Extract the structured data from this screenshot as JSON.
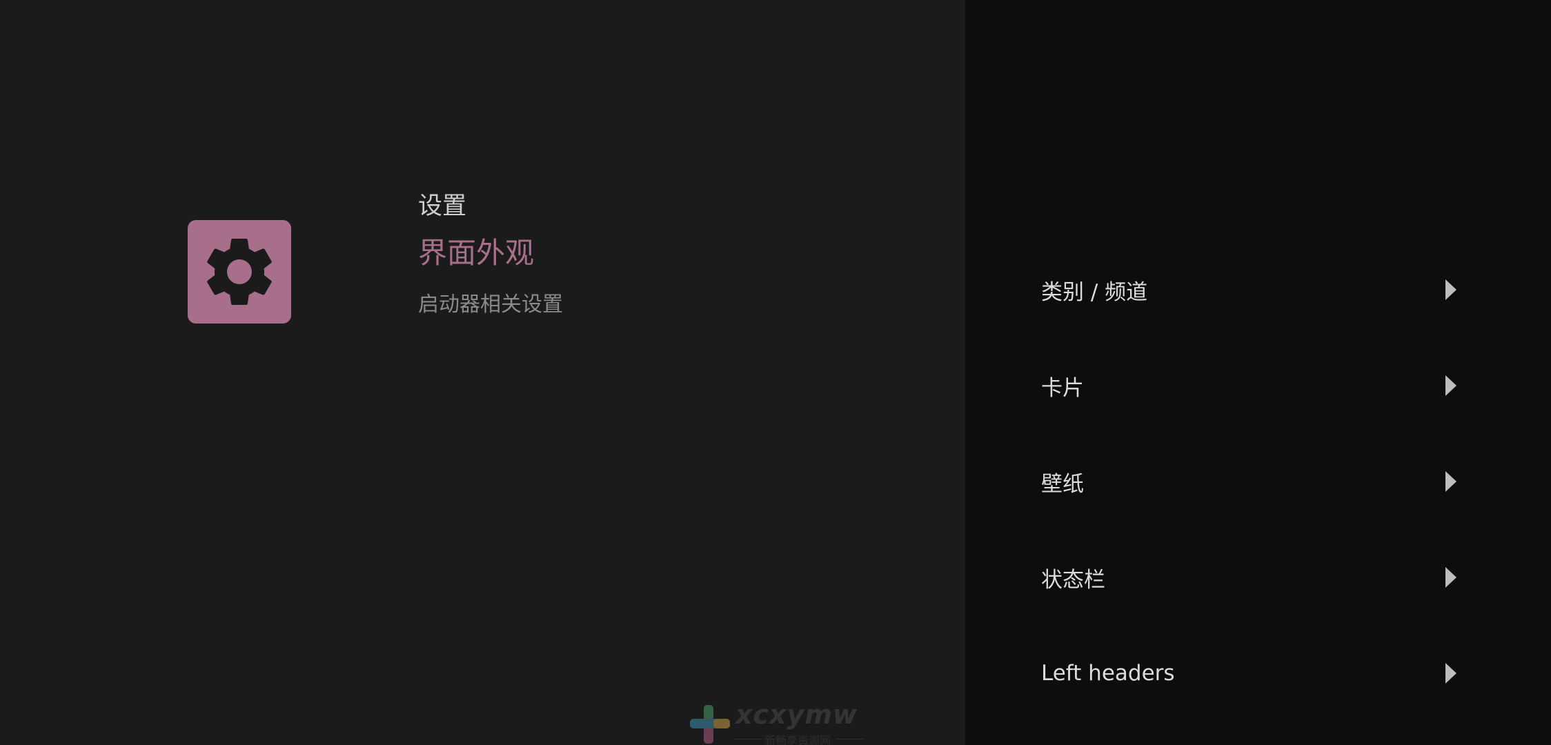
{
  "header": {
    "breadcrumb": "设置",
    "title": "界面外观",
    "description": "启动器相关设置",
    "icon": "gear-icon"
  },
  "menu": {
    "items": [
      {
        "label": "类别 / 频道",
        "icon": "chevron-right-icon"
      },
      {
        "label": "卡片",
        "icon": "chevron-right-icon"
      },
      {
        "label": "壁纸",
        "icon": "chevron-right-icon"
      },
      {
        "label": "状态栏",
        "icon": "chevron-right-icon"
      },
      {
        "label": "Left headers",
        "icon": "chevron-right-icon"
      }
    ]
  },
  "watermark": {
    "text": "xcxymw",
    "subtext": "新畅享资源网"
  },
  "colors": {
    "accent": "#a86f8b",
    "left_background": "#1b1b1b",
    "right_background": "#0d0d0d",
    "primary_text": "#dcdcdc",
    "secondary_text": "#8a8a8a"
  }
}
